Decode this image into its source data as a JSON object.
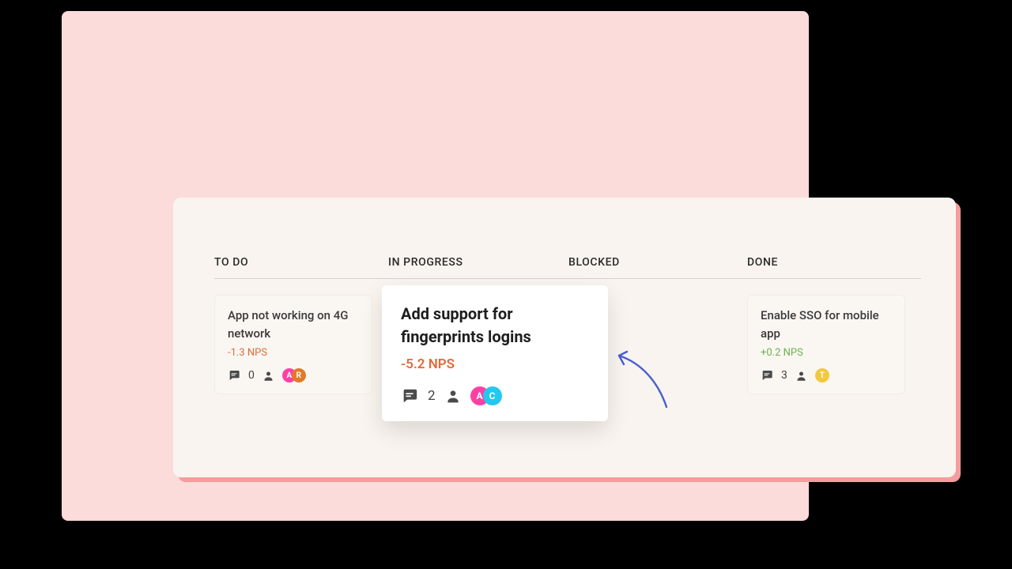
{
  "board": {
    "columns": [
      "TO DO",
      "IN PROGRESS",
      "BLOCKED",
      "DONE"
    ]
  },
  "cards": {
    "todo": {
      "title": "App not working on 4G network",
      "nps": "-1.3 NPS",
      "nps_sign": "neg",
      "comments": "0",
      "assignees": [
        {
          "initial": "A",
          "color": "#ff3fa4"
        },
        {
          "initial": "R",
          "color": "#e07a2c"
        }
      ]
    },
    "in_progress": {
      "title": "Add support for fingerprints logins",
      "nps": "-5.2 NPS",
      "nps_sign": "neg",
      "comments": "2",
      "assignees": [
        {
          "initial": "A",
          "color": "#ff3fa4"
        },
        {
          "initial": "C",
          "color": "#22c8ef"
        }
      ]
    },
    "done": {
      "title": "Enable SSO for mobile app",
      "nps": "+0.2 NPS",
      "nps_sign": "pos",
      "comments": "3",
      "assignees": [
        {
          "initial": "T",
          "color": "#f2c83f"
        }
      ]
    }
  },
  "colors": {
    "pink_panel": "#fcdbdb",
    "board_bg": "#f9f4ef",
    "board_shadow": "#f59c9c",
    "arrow": "#4a5fd0"
  }
}
